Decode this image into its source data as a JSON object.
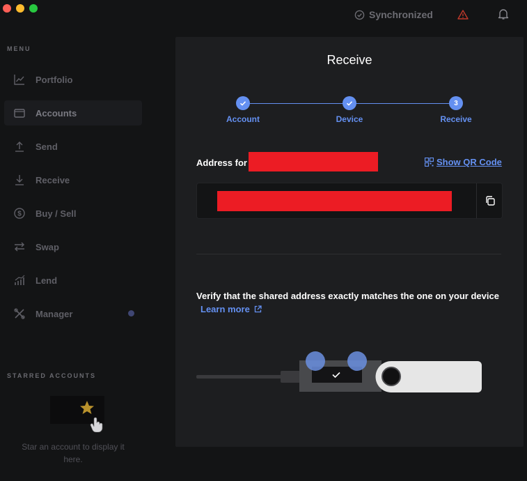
{
  "titlebar": {
    "sync_status": "Synchronized",
    "icons": [
      "check-circle-icon",
      "alert-triangle-icon",
      "bell-icon"
    ]
  },
  "sidebar": {
    "menu_title": "MENU",
    "items": [
      {
        "label": "Portfolio",
        "icon": "chart-icon"
      },
      {
        "label": "Accounts",
        "icon": "wallet-icon",
        "active": true
      },
      {
        "label": "Send",
        "icon": "send-icon"
      },
      {
        "label": "Receive",
        "icon": "receive-icon"
      },
      {
        "label": "Buy / Sell",
        "icon": "dollar-icon"
      },
      {
        "label": "Swap",
        "icon": "swap-icon"
      },
      {
        "label": "Lend",
        "icon": "lend-icon"
      },
      {
        "label": "Manager",
        "icon": "manager-icon",
        "badge": true
      }
    ],
    "starred_title": "STARRED ACCOUNTS",
    "starred_empty_text": "Star an account to display it here."
  },
  "modal": {
    "title": "Receive",
    "steps": [
      {
        "label": "Account",
        "state": "done"
      },
      {
        "label": "Device",
        "state": "done"
      },
      {
        "label": "Receive",
        "state": "current",
        "number": "3"
      }
    ],
    "address_label": "Address for",
    "show_qr_label": "Show QR Code",
    "verify_text": "Verify that the shared address exactly matches the one on your device",
    "learn_more_label": "Learn more"
  },
  "colors": {
    "accent": "#6490f1",
    "redaction": "#ec1c24",
    "background": "#131415",
    "modal_background": "#1d1e20",
    "badge": "#3f4673"
  }
}
